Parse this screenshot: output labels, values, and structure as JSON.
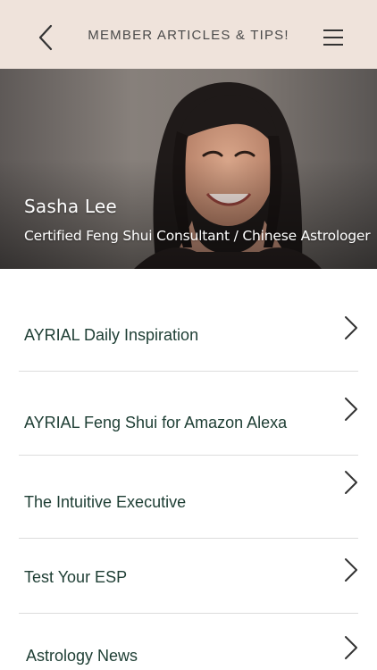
{
  "header": {
    "title": "MEMBER ARTICLES & TIPS!",
    "back_icon": "chevron-left-icon",
    "menu_icon": "hamburger-menu-icon",
    "background_color": "#efe3db"
  },
  "hero": {
    "name": "Sasha Lee",
    "subtitle": "Certified Feng Shui Consultant / Chinese Astrologer"
  },
  "list": {
    "text_color": "#1d3d33",
    "items": [
      {
        "label": "AYRIAL Daily Inspiration"
      },
      {
        "label": "AYRIAL Feng Shui for Amazon Alexa"
      },
      {
        "label": "The Intuitive Executive"
      },
      {
        "label": "Test Your ESP"
      },
      {
        "label": "Astrology News"
      }
    ]
  }
}
